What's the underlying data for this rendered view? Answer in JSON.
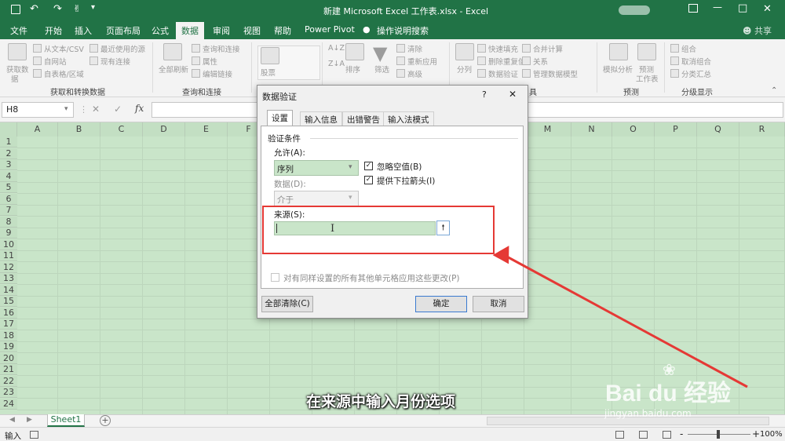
{
  "window": {
    "title": "新建 Microsoft Excel 工作表.xlsx  -  Excel",
    "controls": [
      "—",
      "□",
      "✕"
    ]
  },
  "qat": {
    "icons": [
      "save-icon",
      "undo-icon",
      "redo-icon",
      "touch-icon",
      "customize-icon"
    ]
  },
  "menu": {
    "items": [
      "文件",
      "开始",
      "插入",
      "页面布局",
      "公式",
      "数据",
      "审阅",
      "视图",
      "帮助",
      "Power Pivot",
      "操作说明搜索"
    ],
    "share": "共享"
  },
  "ribbon": {
    "get": {
      "big": "获取数",
      "big2": "据",
      "text_csv": "从文本/CSV",
      "web": "自网站",
      "table": "自表格/区域",
      "recent": "最近使用的源",
      "existing": "现有连接",
      "group": "获取和转换数据"
    },
    "queries": {
      "refresh": "全部刷新",
      "q": "查询和连接",
      "props": "属性",
      "edit": "编辑链接",
      "group": "查询和连接"
    },
    "types": {
      "stock": "股票"
    },
    "sort": {
      "az": "A↓Z",
      "za": "Z↓A",
      "sort": "排序",
      "filter": "筛选",
      "clear": "清除",
      "reapply": "重新应用",
      "advanced": "高级"
    },
    "tools": {
      "split": "分列",
      "flash": "快速填充",
      "dup": "删除重复值",
      "valid": "数据验证",
      "consolidate": "合并计算",
      "rel": "关系",
      "model": "管理数据模型",
      "group": "具"
    },
    "forecast": {
      "whatif": "模拟分析",
      "sheet": "预测",
      "sheet2": "工作表",
      "group": "预测"
    },
    "outline": {
      "grp": "组合",
      "ungrp": "取消组合",
      "subtotal": "分类汇总",
      "group": "分级显示"
    }
  },
  "formula": {
    "namebox": "H8",
    "fx": "fx",
    "cancel": "✕",
    "ok": "✓"
  },
  "grid": {
    "columns": [
      "A",
      "B",
      "C",
      "D",
      "E",
      "F",
      "G",
      "H",
      "I",
      "J",
      "K",
      "L",
      "M",
      "N",
      "O",
      "P",
      "Q",
      "R"
    ],
    "rows": [
      "1",
      "2",
      "3",
      "4",
      "5",
      "6",
      "7",
      "8",
      "9",
      "10",
      "11",
      "12",
      "13",
      "14",
      "15",
      "16",
      "17",
      "18",
      "19",
      "20",
      "21",
      "22",
      "23",
      "24"
    ],
    "selected_cell": "H8"
  },
  "sheets": {
    "tabs": [
      "Sheet1"
    ],
    "add": "+"
  },
  "status": {
    "mode": "输入",
    "zoom": "100%",
    "minus": "-",
    "plus": "+"
  },
  "dialog": {
    "title": "数据验证",
    "help": "?",
    "close": "✕",
    "tabs": [
      "设置",
      "输入信息",
      "出错警告",
      "输入法模式"
    ],
    "section": "验证条件",
    "allow_label": "允许(A):",
    "allow_value": "序列",
    "data_label": "数据(D):",
    "data_value": "介于",
    "ignore_blank": "忽略空值(B)",
    "dropdown": "提供下拉箭头(I)",
    "source_label": "来源(S):",
    "source_value": "",
    "apply_all": "对有同样设置的所有其他单元格应用这些更改(P)",
    "clear_all": "全部清除(C)",
    "ok": "确定",
    "cancel": "取消"
  },
  "caption": "在来源中输入月份选项",
  "watermark": {
    "brand": "Bai du 经验",
    "url": "jingyan.baidu.com"
  },
  "colors": {
    "excel_green": "#217346",
    "highlight_red": "#e53935",
    "grid_green": "#c9e5c9"
  }
}
